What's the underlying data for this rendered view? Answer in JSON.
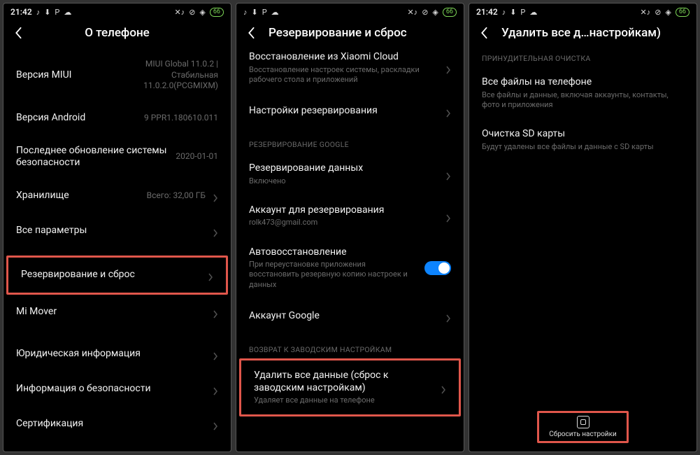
{
  "status": {
    "time": "21:42",
    "battery": "66"
  },
  "screen1": {
    "title": "О телефоне",
    "rows": {
      "miui": {
        "label": "Версия MIUI",
        "value": "MIUI Global 11.0.2 | Стабильная 11.0.2.0(PCGMIXM)"
      },
      "android": {
        "label": "Версия Android",
        "value": "9 PPR1.180610.011"
      },
      "security_patch": {
        "label": "Последнее обновление системы безопасности",
        "value": "2020-01-01"
      },
      "storage": {
        "label": "Хранилище",
        "value": "Всего: 32,00 ГБ"
      },
      "all_params": {
        "label": "Все параметры"
      },
      "backup_reset": {
        "label": "Резервирование и сброс"
      },
      "mi_mover": {
        "label": "Mi Mover"
      },
      "legal": {
        "label": "Юридическая информация"
      },
      "safety": {
        "label": "Информация о безопасности"
      },
      "cert": {
        "label": "Сертификация"
      }
    }
  },
  "screen2": {
    "title": "Резервирование и сброс",
    "cloud": {
      "label": "Восстановление из Xiaomi Cloud",
      "sub": "Восстановление настроек системы, раскладки рабочего стола и приложений"
    },
    "backup_settings": {
      "label": "Настройки резервирования"
    },
    "section_google": "РЕЗЕРВИРОВАНИЕ GOOGLE",
    "data_backup": {
      "label": "Резервирование данных",
      "sub": "Включено"
    },
    "account_backup": {
      "label": "Аккаунт для резервирования",
      "sub": "rolk473@gmail.com"
    },
    "auto_restore": {
      "label": "Автовосстановление",
      "sub": "При переустановке приложения восстановить резервную копию настроек и данных"
    },
    "google_account": {
      "label": "Аккаунт Google"
    },
    "section_factory": "ВОЗВРАТ К ЗАВОДСКИМ НАСТРОЙКАМ",
    "erase_all": {
      "label": "Удалить все данные (сброс к заводским настройкам)",
      "sub": "Удаляет все данные на телефоне"
    }
  },
  "screen3": {
    "title": "Удалить все д…настройкам)",
    "section_force": "ПРИНУДИТЕЛЬНАЯ ОЧИСТКА",
    "all_files": {
      "label": "Все файлы на телефоне",
      "sub": "Все файлы и данные, включая аккаунты, контакты, фото и приложения"
    },
    "sd_card": {
      "label": "Очистка SD карты",
      "sub": "Будут удалены все файлы и данные с SD карты"
    },
    "reset_button": "Сбросить настройки"
  }
}
